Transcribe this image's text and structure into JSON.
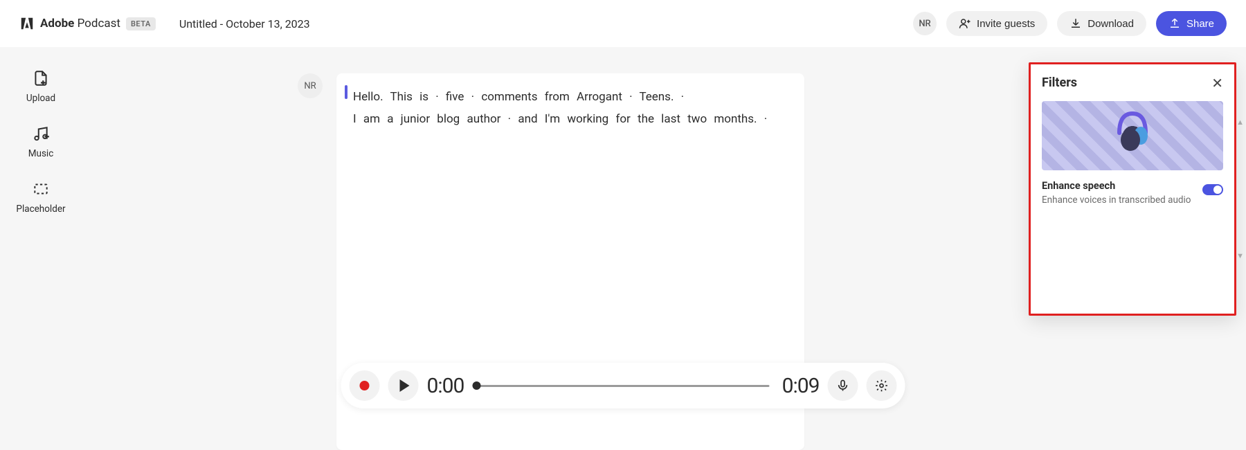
{
  "brand": {
    "name_bold": "Adobe",
    "name_light": "Podcast",
    "badge": "BETA"
  },
  "doc_title": "Untitled - October 13, 2023",
  "user_initials": "NR",
  "header": {
    "invite": "Invite guests",
    "download": "Download",
    "share": "Share"
  },
  "sidebar": {
    "upload": "Upload",
    "music": "Music",
    "placeholder": "Placeholder"
  },
  "transcript": {
    "speaker": "NR",
    "line1": "Hello.  This  is · five · comments  from  Arrogant · Teens. ·",
    "line2": "I  am  a  junior  blog  author · and  I'm  working  for  the  last  two  months. ·"
  },
  "filters": {
    "title": "Filters",
    "enhance_title": "Enhance speech",
    "enhance_desc": "Enhance voices in transcribed audio",
    "enhance_on": true
  },
  "player": {
    "current": "0:00",
    "duration": "0:09"
  }
}
